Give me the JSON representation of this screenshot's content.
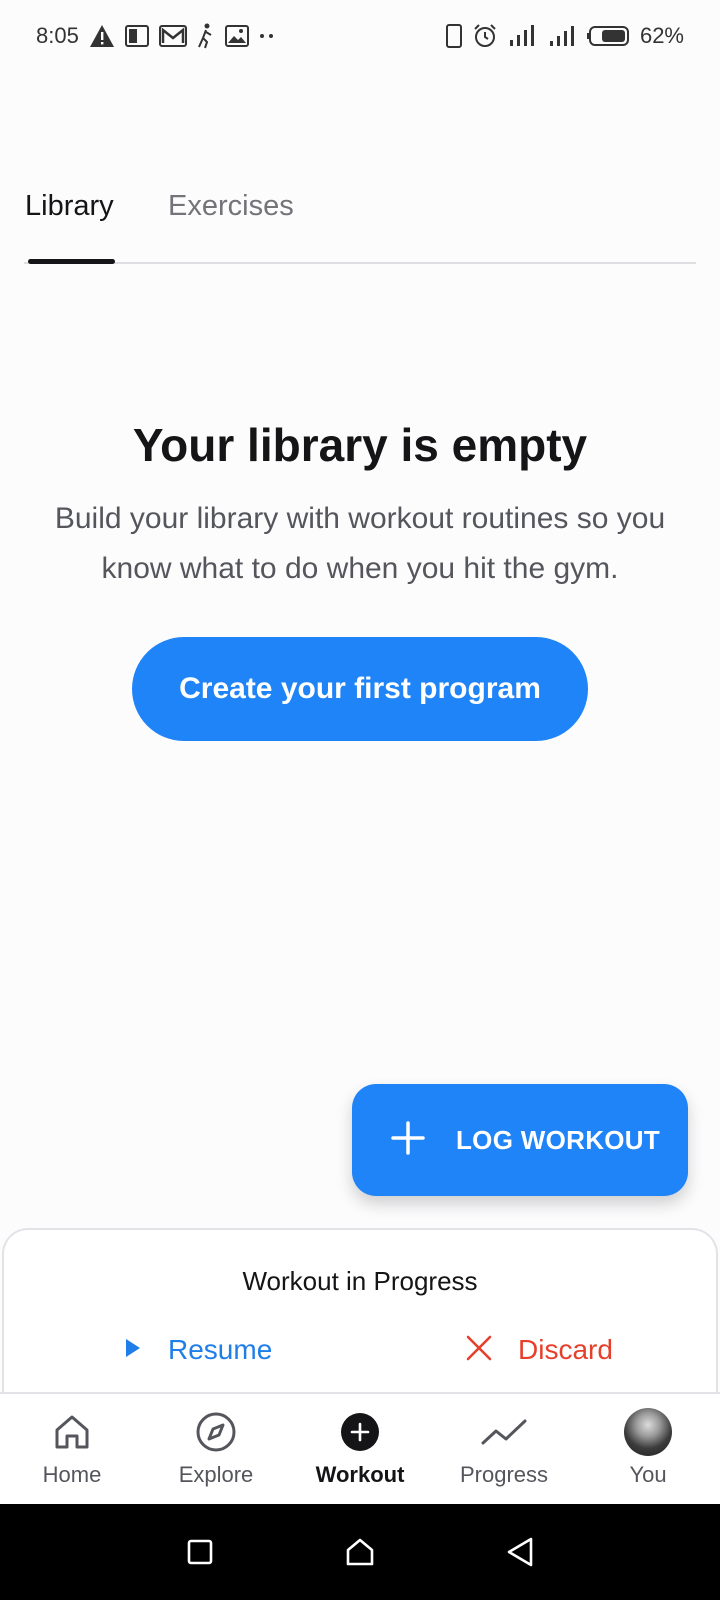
{
  "status_bar": {
    "time": "8:05",
    "battery": "62%",
    "icons_left": [
      "warning-icon",
      "pdf-icon",
      "mail-icon",
      "walking-icon",
      "image-icon",
      "more-dots-icon"
    ],
    "icons_right": [
      "phone-icon",
      "alarm-icon",
      "signal-icon",
      "signal-icon",
      "battery-icon"
    ]
  },
  "tabs": {
    "items": [
      {
        "label": "Library",
        "active": true
      },
      {
        "label": "Exercises",
        "active": false
      }
    ]
  },
  "empty_state": {
    "title": "Your library is empty",
    "description": "Build your library with workout routines so you know what to do when you hit the gym.",
    "button_label": "Create your first program"
  },
  "fab": {
    "label": "LOG WORKOUT",
    "icon": "plus-icon"
  },
  "progress_sheet": {
    "title": "Workout in Progress",
    "resume_label": "Resume",
    "discard_label": "Discard"
  },
  "bottom_nav": {
    "items": [
      {
        "label": "Home",
        "icon": "home-icon"
      },
      {
        "label": "Explore",
        "icon": "compass-icon"
      },
      {
        "label": "Workout",
        "icon": "add-circle-icon",
        "active": true
      },
      {
        "label": "Progress",
        "icon": "trend-line-icon"
      },
      {
        "label": "You",
        "icon": "avatar"
      }
    ]
  },
  "colors": {
    "accent": "#1f84f7",
    "resume": "#1f7ee8",
    "discard": "#e6402c",
    "text_primary": "#151517",
    "text_secondary": "#55565c"
  }
}
